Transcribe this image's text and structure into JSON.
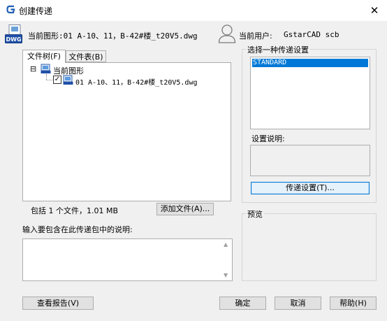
{
  "window": {
    "title": "创建传递",
    "close_glyph": "✕"
  },
  "header": {
    "current_drawing": "当前图形:01 A-10、11，B-42#楼_t20V5.dwg",
    "user_label": "当前用户:",
    "user_name": "GstarCAD scb"
  },
  "tabs": [
    {
      "label": "文件树(F)",
      "active": true
    },
    {
      "label": "文件表(B)",
      "active": false
    }
  ],
  "tree": {
    "root": {
      "label": "当前图形",
      "expander": "⊟"
    },
    "child": {
      "label": "01 A-10、11，B-42#楼_t20V5.dwg",
      "checked": true
    }
  },
  "summary": "包括 1 个文件，1.01 MB",
  "add_file_button": "添加文件(A)...",
  "description": {
    "label": "输入要包含在此传递包中的说明:",
    "value": ""
  },
  "transmittal_settings": {
    "group_label": "选择一种传递设置",
    "items": [
      "STANDARD"
    ],
    "selected": "STANDARD",
    "desc_label": "设置说明:",
    "desc_value": "",
    "settings_button": "传递设置(T)..."
  },
  "preview": {
    "group_label": "预览"
  },
  "footer": {
    "report_button": "查看报告(V)",
    "ok_button": "确定",
    "cancel_button": "取消",
    "help_button": "帮助(H)"
  },
  "icons": {
    "app_logo": "gstarcad-logo-icon",
    "dwg": "dwg-file-icon",
    "user": "user-icon",
    "drawing": "drawing-icon"
  },
  "colors": {
    "selection": "#0078d7",
    "logo": "#1e5fb4"
  }
}
